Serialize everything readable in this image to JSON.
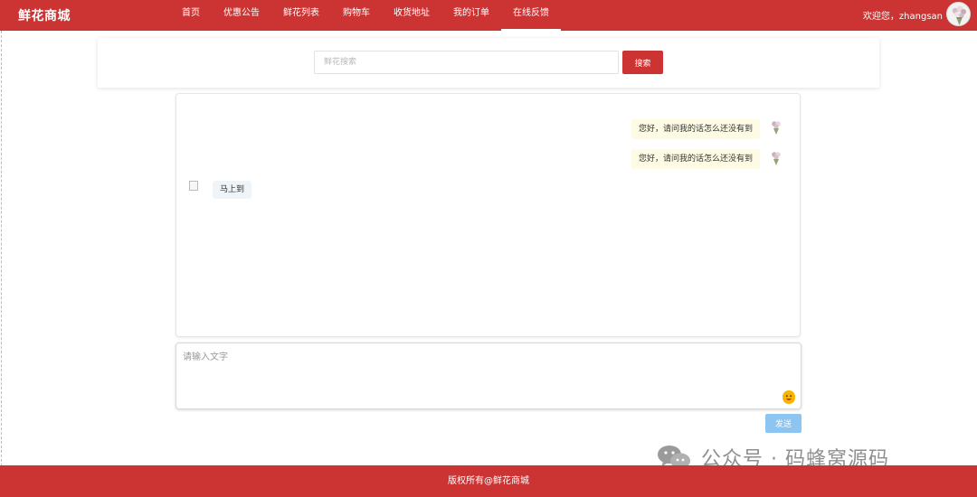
{
  "header": {
    "brand": "鲜花商城",
    "nav": [
      {
        "label": "首页",
        "active": false
      },
      {
        "label": "优惠公告",
        "active": false
      },
      {
        "label": "鲜花列表",
        "active": false
      },
      {
        "label": "购物车",
        "active": false
      },
      {
        "label": "收货地址",
        "active": false
      },
      {
        "label": "我的订单",
        "active": false
      },
      {
        "label": "在线反馈",
        "active": true
      }
    ],
    "welcome": "欢迎您，zhangsan",
    "avatar_icon": "bouquet-avatar-icon"
  },
  "search": {
    "placeholder": "鲜花搜索",
    "value": "",
    "button_label": "搜索"
  },
  "chat": {
    "messages": [
      {
        "side": "right",
        "text": "您好，请问我的话怎么还没有到"
      },
      {
        "side": "right",
        "text": "您好，请问我的话怎么还没有到"
      },
      {
        "side": "left",
        "text": "马上到"
      }
    ]
  },
  "composer": {
    "placeholder": "请输入文字",
    "value": "",
    "emoji_icon": "emoji-smile-icon",
    "send_label": "发送"
  },
  "watermark": {
    "text": "公众号 · 码蜂窝源码",
    "icon": "wechat-icon"
  },
  "footer": {
    "copyright": "版权所有@鲜花商城"
  },
  "colors": {
    "brand_red": "#cc3333",
    "send_blue": "#8cc4f2",
    "bubble_right": "#fdfbe3",
    "bubble_left": "#eef4f8"
  }
}
